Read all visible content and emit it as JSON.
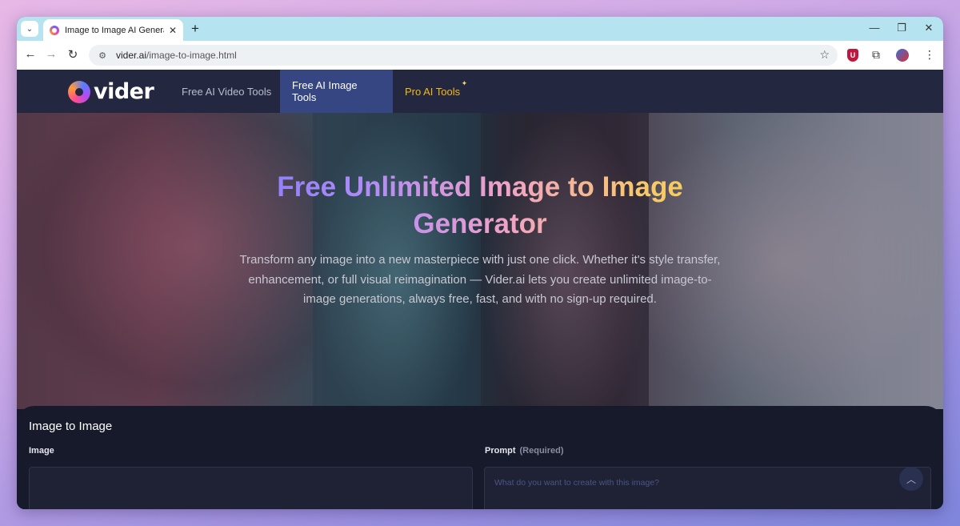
{
  "browser": {
    "tab": {
      "title": "Image to Image AI Generator –",
      "close": "✕"
    },
    "new_tab": "+",
    "tab_menu": "⌄",
    "window_controls": {
      "minimize": "—",
      "restore": "❐",
      "close": "✕"
    },
    "nav": {
      "back": "←",
      "forward": "→",
      "reload": "↻"
    },
    "omnibox": {
      "domain": "vider.ai",
      "path": "/image-to-image.html",
      "site_icon": "⚙",
      "star": "☆"
    },
    "extensions": {
      "ublock": "U",
      "puzzle": "⧉",
      "menu": "⋮"
    }
  },
  "site": {
    "logo": "vider",
    "nav_items": [
      {
        "label": "Free AI Video Tools"
      },
      {
        "label": "Free AI Image Tools"
      },
      {
        "label": "Pro AI Tools"
      }
    ],
    "pro_sparkle": "✦",
    "hero": {
      "title": "Free Unlimited Image to Image Generator",
      "description": "Transform any image into a new masterpiece with just one click. Whether it's style transfer, enhancement, or full visual reimagination — Vider.ai lets you create unlimited image-to-image generations, always free, fast, and with no sign-up required."
    },
    "form": {
      "title": "Image to Image",
      "image_label": "Image",
      "prompt_label": "Prompt",
      "prompt_required": "(Required)",
      "prompt_placeholder": "What do you want to create with this image?"
    },
    "scroll_top": "︿"
  },
  "colors": {
    "tabstrip": "#b6e3f0",
    "site_nav": "#232740",
    "active_nav": "#364682",
    "pro_accent": "#f5b81b",
    "card_bg": "#161a2a"
  }
}
